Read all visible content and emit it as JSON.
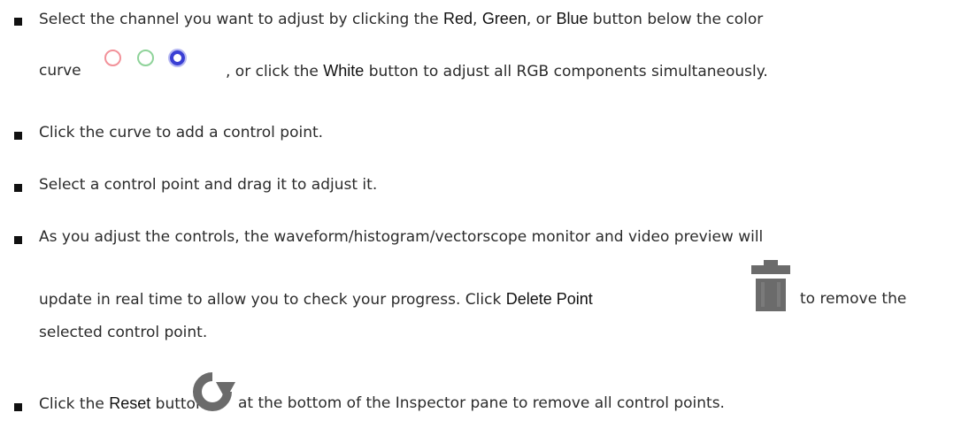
{
  "items": [
    {
      "line1": {
        "t1": "Select the channel you want to adjust by clicking the ",
        "red": "Red",
        "sep1": ", ",
        "green": "Green",
        "sep2": ", or ",
        "blue": "Blue",
        "t2": " button below the color"
      },
      "line2": {
        "t1": "curve",
        "t2": ", or click the ",
        "white": "White",
        "t3": " button to adjust all RGB components simultaneously."
      },
      "icons": [
        "red-circle-icon",
        "green-circle-icon",
        "blue-circle-icon"
      ]
    },
    {
      "text": "Click the curve to add a control point."
    },
    {
      "text": "Select a control point and drag it to adjust it."
    },
    {
      "line1": "As you adjust the controls, the waveform/histogram/vectorscope monitor and video preview will",
      "line2": {
        "t1": "update in real time to allow you to check your progress. Click ",
        "delete": "Delete Point",
        "t2": " to remove the"
      },
      "line3": "selected control point.",
      "icon": "trash-icon"
    },
    {
      "t1": "Click the ",
      "reset": "Reset",
      "t2": " button",
      "t3": " at the bottom of the Inspector pane to remove all control points.",
      "icon": "reset-icon"
    }
  ],
  "colors": {
    "red_ring": "#f2929a",
    "green_ring": "#8fd39a",
    "blue_ring": "#3a3fd4",
    "icon_gray": "#6b6b6b"
  }
}
